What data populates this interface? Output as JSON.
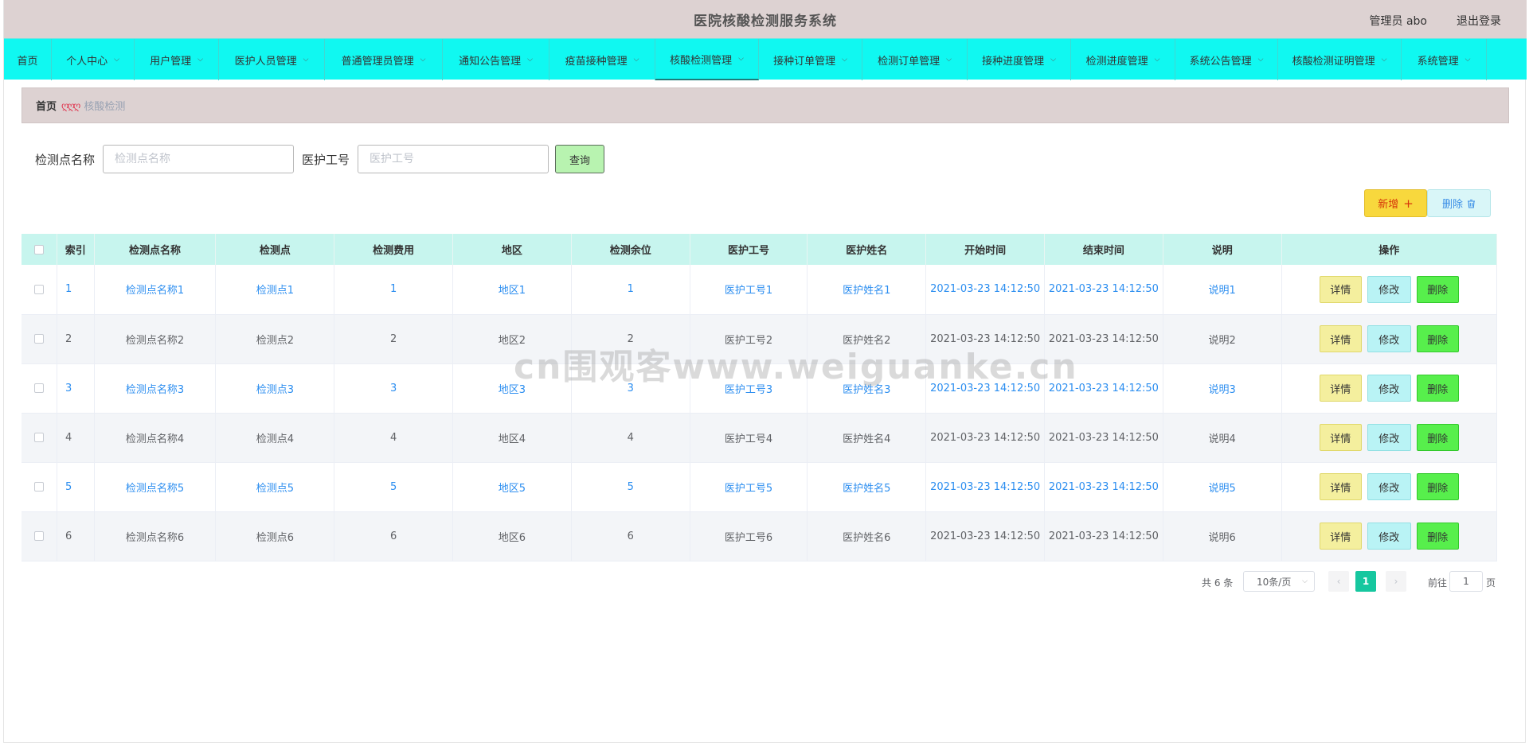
{
  "header": {
    "title": "医院核酸检测服务系统",
    "user": "管理员 abo",
    "logout": "退出登录"
  },
  "nav": [
    {
      "label": "首页",
      "dropdown": false
    },
    {
      "label": "个人中心",
      "dropdown": true
    },
    {
      "label": "用户管理",
      "dropdown": true
    },
    {
      "label": "医护人员管理",
      "dropdown": true
    },
    {
      "label": "普通管理员管理",
      "dropdown": true
    },
    {
      "label": "通知公告管理",
      "dropdown": true
    },
    {
      "label": "疫苗接种管理",
      "dropdown": true
    },
    {
      "label": "核酸检测管理",
      "dropdown": true,
      "active": true
    },
    {
      "label": "接种订单管理",
      "dropdown": true
    },
    {
      "label": "检测订单管理",
      "dropdown": true
    },
    {
      "label": "接种进度管理",
      "dropdown": true
    },
    {
      "label": "检测进度管理",
      "dropdown": true
    },
    {
      "label": "系统公告管理",
      "dropdown": true
    },
    {
      "label": "核酸检测证明管理",
      "dropdown": true
    },
    {
      "label": "系统管理",
      "dropdown": true
    }
  ],
  "breadcrumb": {
    "home": "首页",
    "separator": "ღღღ",
    "current": "核酸检测"
  },
  "search": {
    "field1_label": "检测点名称",
    "field1_placeholder": "检测点名称",
    "field2_label": "医护工号",
    "field2_placeholder": "医护工号",
    "query_button": "查询"
  },
  "actions": {
    "add": "新增",
    "add_icon": "+",
    "delete": "删除",
    "delete_icon": "trash-icon"
  },
  "table": {
    "columns": [
      "索引",
      "检测点名称",
      "检测点",
      "检测费用",
      "地区",
      "检测余位",
      "医护工号",
      "医护姓名",
      "开始时间",
      "结束时间",
      "说明",
      "操作"
    ],
    "rows": [
      {
        "index": "1",
        "name": "检测点名称1",
        "point": "检测点1",
        "fee": "1",
        "region": "地区1",
        "remaining": "1",
        "staff_id": "医护工号1",
        "staff_name": "医护姓名1",
        "start": "2021-03-23 14:12:50",
        "end": "2021-03-23 14:12:50",
        "note": "说明1"
      },
      {
        "index": "2",
        "name": "检测点名称2",
        "point": "检测点2",
        "fee": "2",
        "region": "地区2",
        "remaining": "2",
        "staff_id": "医护工号2",
        "staff_name": "医护姓名2",
        "start": "2021-03-23 14:12:50",
        "end": "2021-03-23 14:12:50",
        "note": "说明2"
      },
      {
        "index": "3",
        "name": "检测点名称3",
        "point": "检测点3",
        "fee": "3",
        "region": "地区3",
        "remaining": "3",
        "staff_id": "医护工号3",
        "staff_name": "医护姓名3",
        "start": "2021-03-23 14:12:50",
        "end": "2021-03-23 14:12:50",
        "note": "说明3"
      },
      {
        "index": "4",
        "name": "检测点名称4",
        "point": "检测点4",
        "fee": "4",
        "region": "地区4",
        "remaining": "4",
        "staff_id": "医护工号4",
        "staff_name": "医护姓名4",
        "start": "2021-03-23 14:12:50",
        "end": "2021-03-23 14:12:50",
        "note": "说明4"
      },
      {
        "index": "5",
        "name": "检测点名称5",
        "point": "检测点5",
        "fee": "5",
        "region": "地区5",
        "remaining": "5",
        "staff_id": "医护工号5",
        "staff_name": "医护姓名5",
        "start": "2021-03-23 14:12:50",
        "end": "2021-03-23 14:12:50",
        "note": "说明5"
      },
      {
        "index": "6",
        "name": "检测点名称6",
        "point": "检测点6",
        "fee": "6",
        "region": "地区6",
        "remaining": "6",
        "staff_id": "医护工号6",
        "staff_name": "医护姓名6",
        "start": "2021-03-23 14:12:50",
        "end": "2021-03-23 14:12:50",
        "note": "说明6"
      }
    ],
    "row_actions": {
      "detail": "详情",
      "edit": "修改",
      "remove": "删除"
    }
  },
  "pagination": {
    "total": "共 6 条",
    "page_size": "10条/页",
    "prev": "‹",
    "current": "1",
    "next": "›",
    "goto_label": "前往",
    "goto_value": "1",
    "page_suffix": "页"
  },
  "watermark": "cn围观客www.weiguanke.cn",
  "colors": {
    "header_bg": "#ddd2d2",
    "nav_bg": "#10f8f1",
    "table_header_bg": "#c7f5ee",
    "link_blue": "#2c8ef0",
    "add_button": "#f8d83d",
    "detail_button": "#f4ef9e",
    "edit_button": "#b9f3f5",
    "remove_button": "#57ef4c",
    "pager_active": "#16c79f"
  }
}
